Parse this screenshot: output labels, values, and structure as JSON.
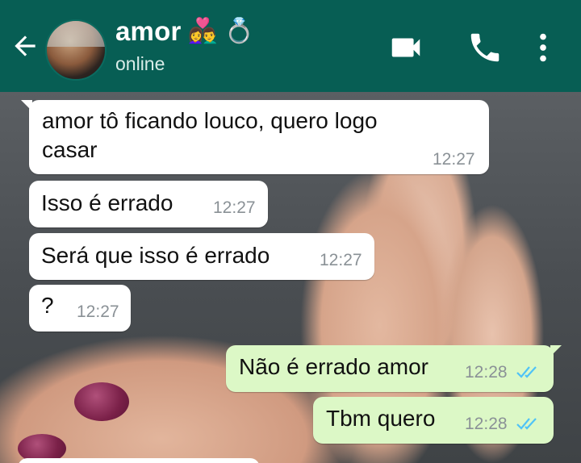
{
  "header": {
    "back_icon": "arrow-left-icon",
    "contact_name": "amor",
    "name_emojis": [
      "👩‍❤️‍👨",
      "💍"
    ],
    "status": "online",
    "video_icon": "video-camera-icon",
    "call_icon": "phone-icon",
    "menu_icon": "more-vert-icon",
    "bar_color": "#075e54"
  },
  "messages": [
    {
      "direction": "in",
      "text_line1": "amor tô ficando louco, quero logo",
      "text_line2": "casar",
      "time": "12:27"
    },
    {
      "direction": "in",
      "text": "Isso é errado",
      "time": "12:27"
    },
    {
      "direction": "in",
      "text": "Será que isso é errado",
      "time": "12:27"
    },
    {
      "direction": "in",
      "text": "?",
      "time": "12:27"
    },
    {
      "direction": "out",
      "text": "Não é errado amor",
      "time": "12:28",
      "status": "read"
    },
    {
      "direction": "out",
      "text": "Tbm quero",
      "time": "12:28",
      "status": "read"
    }
  ],
  "colors": {
    "incoming_bubble": "#ffffff",
    "outgoing_bubble": "#dcf8c6",
    "read_ticks": "#4fc3f7"
  }
}
